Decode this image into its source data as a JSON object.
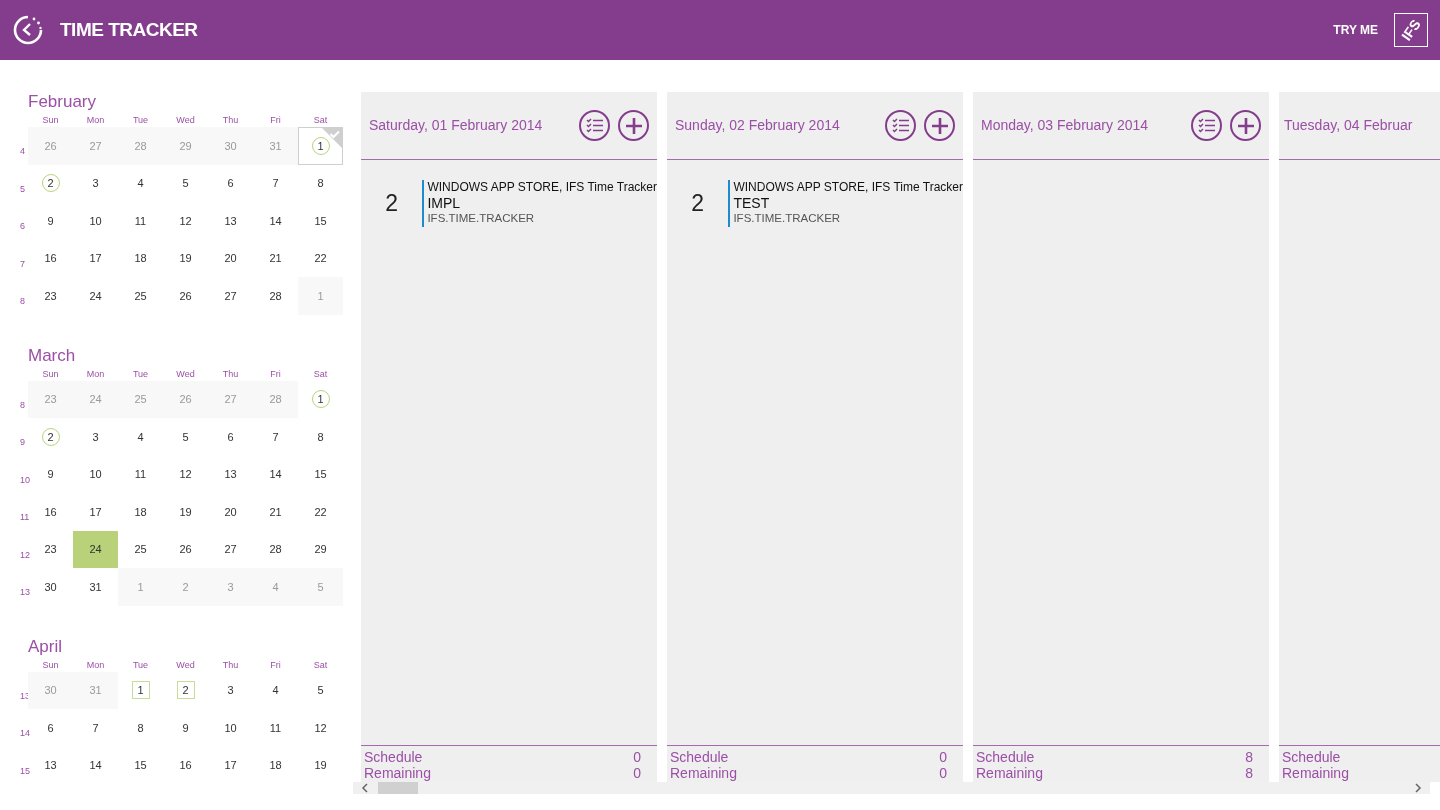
{
  "app_bar": {
    "title": "TIME TRACKER",
    "try_me": "TRY ME",
    "logo_text": "IFS"
  },
  "calendar": {
    "months": [
      {
        "name": "February",
        "weekdays": [
          "Sun",
          "Mon",
          "Tue",
          "Wed",
          "Thu",
          "Fri",
          "Sat"
        ],
        "weeks": [
          {
            "number": "4",
            "days": [
              {
                "day": "26",
                "kind": "plain",
                "outside": true,
                "selected": false,
                "today": false
              },
              {
                "day": "27",
                "kind": "plain",
                "outside": true,
                "selected": false,
                "today": false
              },
              {
                "day": "28",
                "kind": "plain",
                "outside": true,
                "selected": false,
                "today": false
              },
              {
                "day": "29",
                "kind": "plain",
                "outside": true,
                "selected": false,
                "today": false
              },
              {
                "day": "30",
                "kind": "plain",
                "outside": true,
                "selected": false,
                "today": false
              },
              {
                "day": "31",
                "kind": "plain",
                "outside": true,
                "selected": false,
                "today": false
              },
              {
                "day": "1",
                "kind": "circle",
                "outside": false,
                "selected": true,
                "today": false
              }
            ]
          },
          {
            "number": "5",
            "days": [
              {
                "day": "2",
                "kind": "circle",
                "outside": false,
                "selected": false,
                "today": false
              },
              {
                "day": "3",
                "kind": "plain",
                "outside": false,
                "selected": false,
                "today": false
              },
              {
                "day": "4",
                "kind": "plain",
                "outside": false,
                "selected": false,
                "today": false
              },
              {
                "day": "5",
                "kind": "plain",
                "outside": false,
                "selected": false,
                "today": false
              },
              {
                "day": "6",
                "kind": "plain",
                "outside": false,
                "selected": false,
                "today": false
              },
              {
                "day": "7",
                "kind": "plain",
                "outside": false,
                "selected": false,
                "today": false
              },
              {
                "day": "8",
                "kind": "plain",
                "outside": false,
                "selected": false,
                "today": false
              }
            ]
          },
          {
            "number": "6",
            "days": [
              {
                "day": "9",
                "kind": "plain",
                "outside": false,
                "selected": false,
                "today": false
              },
              {
                "day": "10",
                "kind": "plain",
                "outside": false,
                "selected": false,
                "today": false
              },
              {
                "day": "11",
                "kind": "plain",
                "outside": false,
                "selected": false,
                "today": false
              },
              {
                "day": "12",
                "kind": "plain",
                "outside": false,
                "selected": false,
                "today": false
              },
              {
                "day": "13",
                "kind": "plain",
                "outside": false,
                "selected": false,
                "today": false
              },
              {
                "day": "14",
                "kind": "plain",
                "outside": false,
                "selected": false,
                "today": false
              },
              {
                "day": "15",
                "kind": "plain",
                "outside": false,
                "selected": false,
                "today": false
              }
            ]
          },
          {
            "number": "7",
            "days": [
              {
                "day": "16",
                "kind": "plain",
                "outside": false,
                "selected": false,
                "today": false
              },
              {
                "day": "17",
                "kind": "plain",
                "outside": false,
                "selected": false,
                "today": false
              },
              {
                "day": "18",
                "kind": "plain",
                "outside": false,
                "selected": false,
                "today": false
              },
              {
                "day": "19",
                "kind": "plain",
                "outside": false,
                "selected": false,
                "today": false
              },
              {
                "day": "20",
                "kind": "plain",
                "outside": false,
                "selected": false,
                "today": false
              },
              {
                "day": "21",
                "kind": "plain",
                "outside": false,
                "selected": false,
                "today": false
              },
              {
                "day": "22",
                "kind": "plain",
                "outside": false,
                "selected": false,
                "today": false
              }
            ]
          },
          {
            "number": "8",
            "days": [
              {
                "day": "23",
                "kind": "plain",
                "outside": false,
                "selected": false,
                "today": false
              },
              {
                "day": "24",
                "kind": "plain",
                "outside": false,
                "selected": false,
                "today": false
              },
              {
                "day": "25",
                "kind": "plain",
                "outside": false,
                "selected": false,
                "today": false
              },
              {
                "day": "26",
                "kind": "plain",
                "outside": false,
                "selected": false,
                "today": false
              },
              {
                "day": "27",
                "kind": "plain",
                "outside": false,
                "selected": false,
                "today": false
              },
              {
                "day": "28",
                "kind": "plain",
                "outside": false,
                "selected": false,
                "today": false
              },
              {
                "day": "1",
                "kind": "plain",
                "outside": true,
                "selected": false,
                "today": false
              }
            ]
          }
        ]
      },
      {
        "name": "March",
        "weekdays": [
          "Sun",
          "Mon",
          "Tue",
          "Wed",
          "Thu",
          "Fri",
          "Sat"
        ],
        "weeks": [
          {
            "number": "8",
            "days": [
              {
                "day": "23",
                "kind": "plain",
                "outside": true,
                "selected": false,
                "today": false
              },
              {
                "day": "24",
                "kind": "plain",
                "outside": true,
                "selected": false,
                "today": false
              },
              {
                "day": "25",
                "kind": "plain",
                "outside": true,
                "selected": false,
                "today": false
              },
              {
                "day": "26",
                "kind": "plain",
                "outside": true,
                "selected": false,
                "today": false
              },
              {
                "day": "27",
                "kind": "plain",
                "outside": true,
                "selected": false,
                "today": false
              },
              {
                "day": "28",
                "kind": "plain",
                "outside": true,
                "selected": false,
                "today": false
              },
              {
                "day": "1",
                "kind": "circle",
                "outside": false,
                "selected": false,
                "today": false
              }
            ]
          },
          {
            "number": "9",
            "days": [
              {
                "day": "2",
                "kind": "circle",
                "outside": false,
                "selected": false,
                "today": false
              },
              {
                "day": "3",
                "kind": "plain",
                "outside": false,
                "selected": false,
                "today": false
              },
              {
                "day": "4",
                "kind": "plain",
                "outside": false,
                "selected": false,
                "today": false
              },
              {
                "day": "5",
                "kind": "plain",
                "outside": false,
                "selected": false,
                "today": false
              },
              {
                "day": "6",
                "kind": "plain",
                "outside": false,
                "selected": false,
                "today": false
              },
              {
                "day": "7",
                "kind": "plain",
                "outside": false,
                "selected": false,
                "today": false
              },
              {
                "day": "8",
                "kind": "plain",
                "outside": false,
                "selected": false,
                "today": false
              }
            ]
          },
          {
            "number": "10",
            "days": [
              {
                "day": "9",
                "kind": "plain",
                "outside": false,
                "selected": false,
                "today": false
              },
              {
                "day": "10",
                "kind": "plain",
                "outside": false,
                "selected": false,
                "today": false
              },
              {
                "day": "11",
                "kind": "plain",
                "outside": false,
                "selected": false,
                "today": false
              },
              {
                "day": "12",
                "kind": "plain",
                "outside": false,
                "selected": false,
                "today": false
              },
              {
                "day": "13",
                "kind": "plain",
                "outside": false,
                "selected": false,
                "today": false
              },
              {
                "day": "14",
                "kind": "plain",
                "outside": false,
                "selected": false,
                "today": false
              },
              {
                "day": "15",
                "kind": "plain",
                "outside": false,
                "selected": false,
                "today": false
              }
            ]
          },
          {
            "number": "11",
            "days": [
              {
                "day": "16",
                "kind": "plain",
                "outside": false,
                "selected": false,
                "today": false
              },
              {
                "day": "17",
                "kind": "plain",
                "outside": false,
                "selected": false,
                "today": false
              },
              {
                "day": "18",
                "kind": "plain",
                "outside": false,
                "selected": false,
                "today": false
              },
              {
                "day": "19",
                "kind": "plain",
                "outside": false,
                "selected": false,
                "today": false
              },
              {
                "day": "20",
                "kind": "plain",
                "outside": false,
                "selected": false,
                "today": false
              },
              {
                "day": "21",
                "kind": "plain",
                "outside": false,
                "selected": false,
                "today": false
              },
              {
                "day": "22",
                "kind": "plain",
                "outside": false,
                "selected": false,
                "today": false
              }
            ]
          },
          {
            "number": "12",
            "days": [
              {
                "day": "23",
                "kind": "plain",
                "outside": false,
                "selected": false,
                "today": false
              },
              {
                "day": "24",
                "kind": "plain",
                "outside": false,
                "selected": false,
                "today": true
              },
              {
                "day": "25",
                "kind": "plain",
                "outside": false,
                "selected": false,
                "today": false
              },
              {
                "day": "26",
                "kind": "plain",
                "outside": false,
                "selected": false,
                "today": false
              },
              {
                "day": "27",
                "kind": "plain",
                "outside": false,
                "selected": false,
                "today": false
              },
              {
                "day": "28",
                "kind": "plain",
                "outside": false,
                "selected": false,
                "today": false
              },
              {
                "day": "29",
                "kind": "plain",
                "outside": false,
                "selected": false,
                "today": false
              }
            ]
          },
          {
            "number": "13",
            "days": [
              {
                "day": "30",
                "kind": "plain",
                "outside": false,
                "selected": false,
                "today": false
              },
              {
                "day": "31",
                "kind": "plain",
                "outside": false,
                "selected": false,
                "today": false
              },
              {
                "day": "1",
                "kind": "plain",
                "outside": true,
                "selected": false,
                "today": false
              },
              {
                "day": "2",
                "kind": "plain",
                "outside": true,
                "selected": false,
                "today": false
              },
              {
                "day": "3",
                "kind": "plain",
                "outside": true,
                "selected": false,
                "today": false
              },
              {
                "day": "4",
                "kind": "plain",
                "outside": true,
                "selected": false,
                "today": false
              },
              {
                "day": "5",
                "kind": "plain",
                "outside": true,
                "selected": false,
                "today": false
              }
            ]
          }
        ]
      },
      {
        "name": "April",
        "weekdays": [
          "Sun",
          "Mon",
          "Tue",
          "Wed",
          "Thu",
          "Fri",
          "Sat"
        ],
        "weeks": [
          {
            "number": "13",
            "days": [
              {
                "day": "30",
                "kind": "plain",
                "outside": true,
                "selected": false,
                "today": false
              },
              {
                "day": "31",
                "kind": "plain",
                "outside": true,
                "selected": false,
                "today": false
              },
              {
                "day": "1",
                "kind": "square",
                "outside": false,
                "selected": false,
                "today": false
              },
              {
                "day": "2",
                "kind": "square",
                "outside": false,
                "selected": false,
                "today": false
              },
              {
                "day": "3",
                "kind": "plain",
                "outside": false,
                "selected": false,
                "today": false
              },
              {
                "day": "4",
                "kind": "plain",
                "outside": false,
                "selected": false,
                "today": false
              },
              {
                "day": "5",
                "kind": "plain",
                "outside": false,
                "selected": false,
                "today": false
              }
            ]
          },
          {
            "number": "14",
            "days": [
              {
                "day": "6",
                "kind": "plain",
                "outside": false,
                "selected": false,
                "today": false
              },
              {
                "day": "7",
                "kind": "plain",
                "outside": false,
                "selected": false,
                "today": false
              },
              {
                "day": "8",
                "kind": "plain",
                "outside": false,
                "selected": false,
                "today": false
              },
              {
                "day": "9",
                "kind": "plain",
                "outside": false,
                "selected": false,
                "today": false
              },
              {
                "day": "10",
                "kind": "plain",
                "outside": false,
                "selected": false,
                "today": false
              },
              {
                "day": "11",
                "kind": "plain",
                "outside": false,
                "selected": false,
                "today": false
              },
              {
                "day": "12",
                "kind": "plain",
                "outside": false,
                "selected": false,
                "today": false
              }
            ]
          },
          {
            "number": "15",
            "days": [
              {
                "day": "13",
                "kind": "plain",
                "outside": false,
                "selected": false,
                "today": false
              },
              {
                "day": "14",
                "kind": "plain",
                "outside": false,
                "selected": false,
                "today": false
              },
              {
                "day": "15",
                "kind": "plain",
                "outside": false,
                "selected": false,
                "today": false
              },
              {
                "day": "16",
                "kind": "plain",
                "outside": false,
                "selected": false,
                "today": false
              },
              {
                "day": "17",
                "kind": "plain",
                "outside": false,
                "selected": false,
                "today": false
              },
              {
                "day": "18",
                "kind": "plain",
                "outside": false,
                "selected": false,
                "today": false
              },
              {
                "day": "19",
                "kind": "plain",
                "outside": false,
                "selected": false,
                "today": false
              }
            ]
          }
        ]
      }
    ]
  },
  "day_columns": [
    {
      "title": "Saturday, 01 February 2014",
      "actions": [
        {
          "kind": "checklist"
        },
        {
          "kind": "add"
        }
      ],
      "entries": [
        {
          "hours": "2",
          "customer": "WINDOWS APP STORE, IFS Time Tracker",
          "activity": "IMPL",
          "project": "IFS.TIME.TRACKER"
        }
      ],
      "totals": [
        {
          "label": "Schedule",
          "value": "0"
        },
        {
          "label": "Remaining",
          "value": "0"
        }
      ]
    },
    {
      "title": "Sunday, 02 February 2014",
      "actions": [
        {
          "kind": "checklist"
        },
        {
          "kind": "add"
        }
      ],
      "entries": [
        {
          "hours": "2",
          "customer": "WINDOWS APP STORE, IFS Time Tracker",
          "activity": "TEST",
          "project": "IFS.TIME.TRACKER"
        }
      ],
      "totals": [
        {
          "label": "Schedule",
          "value": "0"
        },
        {
          "label": "Remaining",
          "value": "0"
        }
      ]
    },
    {
      "title": "Monday, 03 February 2014",
      "actions": [
        {
          "kind": "checklist"
        },
        {
          "kind": "add"
        }
      ],
      "totals": [
        {
          "label": "Schedule",
          "value": "8"
        },
        {
          "label": "Remaining",
          "value": "8"
        }
      ]
    },
    {
      "title": "Tuesday, 04 Februar",
      "totals": [
        {
          "label": "Schedule"
        },
        {
          "label": "Remaining"
        }
      ]
    }
  ]
}
